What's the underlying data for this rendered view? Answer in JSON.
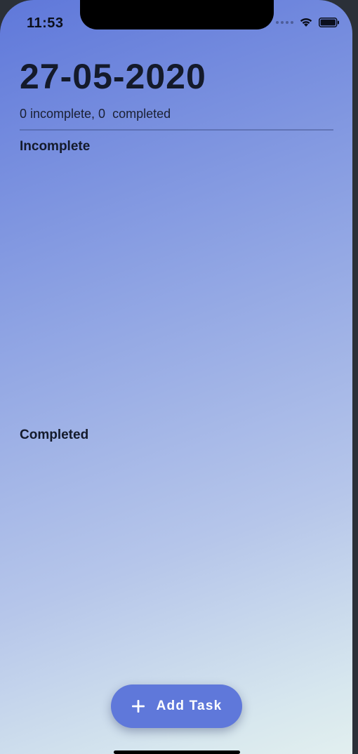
{
  "status_bar": {
    "time": "11:53",
    "wifi_icon": "wifi-icon",
    "battery_icon": "battery-icon"
  },
  "header": {
    "date": "27-05-2020",
    "summary": "0 incomplete, 0  completed"
  },
  "sections": {
    "incomplete_title": "Incomplete",
    "completed_title": "Completed"
  },
  "fab": {
    "icon": "plus-icon",
    "label": "Add Task"
  },
  "colors": {
    "accent": "#5f78da",
    "gradient_top": "#5f78da",
    "gradient_bottom": "#e2efef",
    "text_dark": "#141a2b"
  }
}
